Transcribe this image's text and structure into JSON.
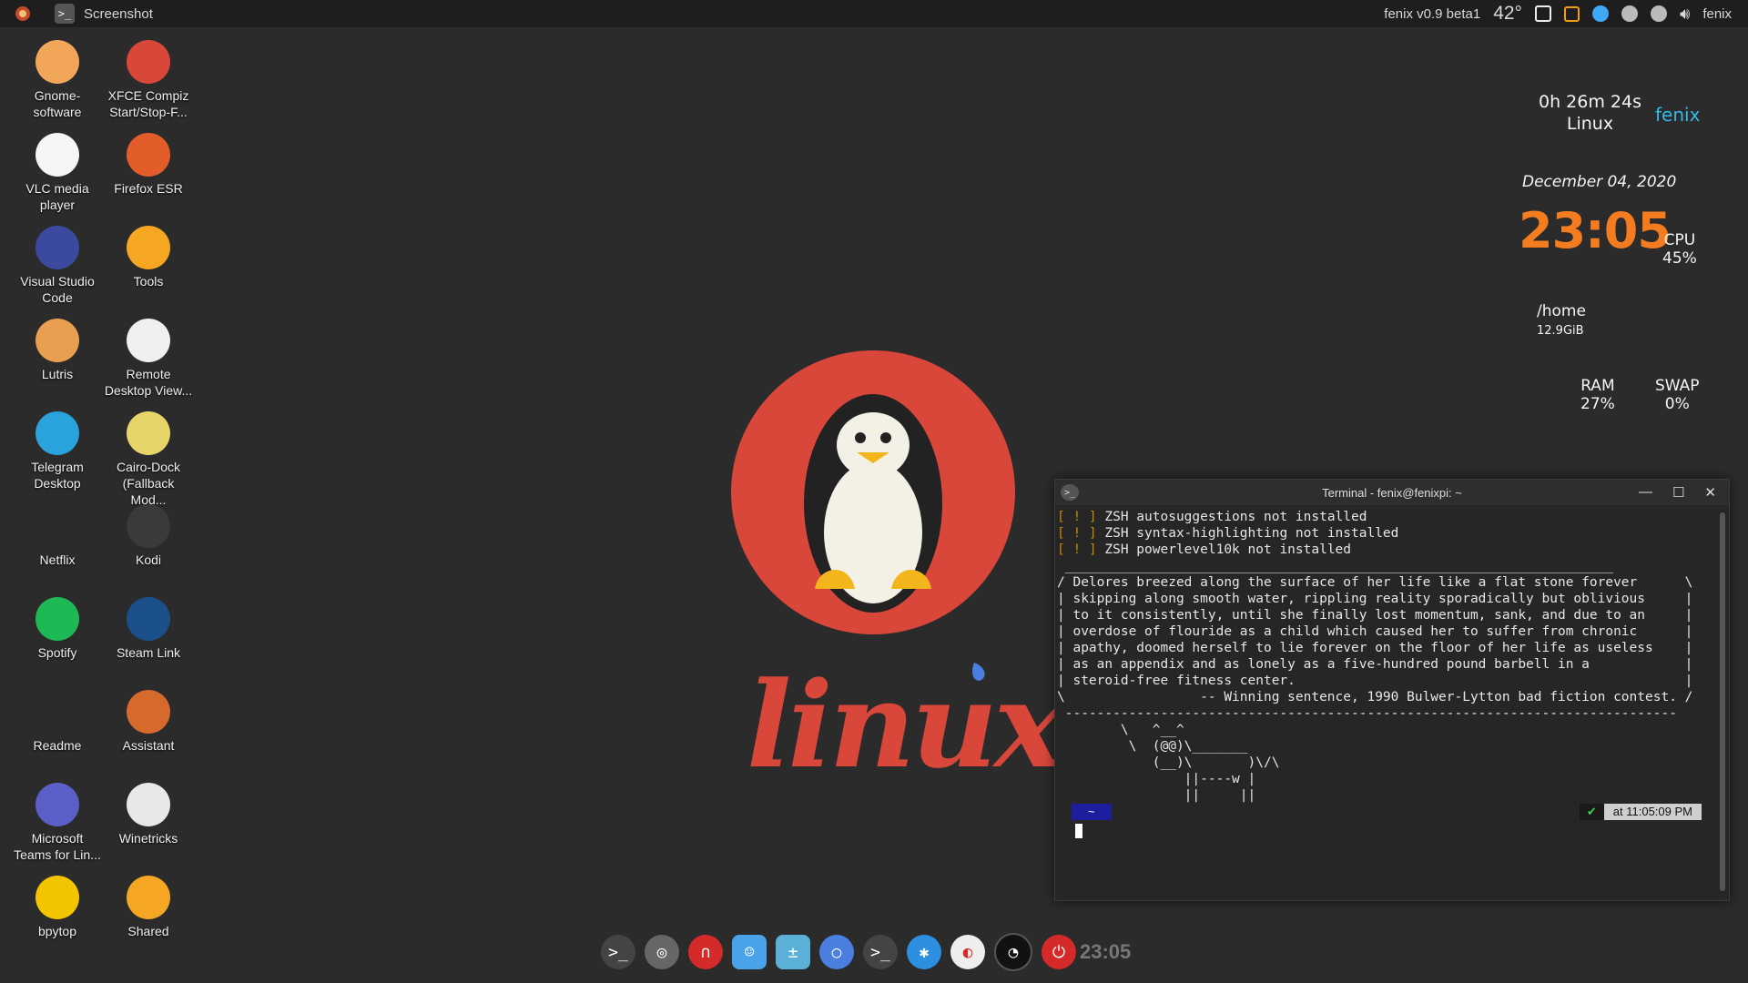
{
  "panel": {
    "active_app": "Screenshot",
    "version": "fenix v0.9 beta1",
    "temperature": "42°",
    "user": "fenix"
  },
  "desktop_icons": [
    {
      "label": "Gnome-software",
      "icon": "gnome-software-icon",
      "color": "#f2a65a"
    },
    {
      "label": "XFCE Compiz Start/Stop-F...",
      "icon": "compiz-icon",
      "color": "#d9473a"
    },
    {
      "label": "VLC media player",
      "icon": "vlc-icon",
      "color": "#f5f5f5"
    },
    {
      "label": "Firefox ESR",
      "icon": "firefox-icon",
      "color": "#e35d2a"
    },
    {
      "label": "Visual Studio Code",
      "icon": "vscode-icon",
      "color": "#3b4a9e"
    },
    {
      "label": "Tools",
      "icon": "folder-icon",
      "color": "#f5a623"
    },
    {
      "label": "Lutris",
      "icon": "lutris-icon",
      "color": "#e8a050"
    },
    {
      "label": "Remote Desktop View...",
      "icon": "remote-desktop-icon",
      "color": "#f0f0f0"
    },
    {
      "label": "Telegram Desktop",
      "icon": "telegram-icon",
      "color": "#2aa3dc"
    },
    {
      "label": "Cairo-Dock (Fallback Mod...",
      "icon": "cairo-dock-icon",
      "color": "#e8d56a"
    },
    {
      "label": "Netflix",
      "icon": "netflix-icon",
      "color": "#2b2b2b"
    },
    {
      "label": "Kodi",
      "icon": "kodi-icon",
      "color": "#3a3a3a"
    },
    {
      "label": "Spotify",
      "icon": "spotify-icon",
      "color": "#1db954"
    },
    {
      "label": "Steam Link",
      "icon": "steam-link-icon",
      "color": "#1b4f8a"
    },
    {
      "label": "Readme",
      "icon": "readme-icon",
      "color": "#2b2b2b"
    },
    {
      "label": "Assistant",
      "icon": "assistant-icon",
      "color": "#d66a2c"
    },
    {
      "label": "Microsoft Teams for Lin...",
      "icon": "teams-icon",
      "color": "#5b5fc7"
    },
    {
      "label": "Winetricks",
      "icon": "winetricks-icon",
      "color": "#e8e8e8"
    },
    {
      "label": "bpytop",
      "icon": "bpytop-icon",
      "color": "#f2c500"
    },
    {
      "label": "Shared",
      "icon": "shared-folder-icon",
      "color": "#f5a623"
    }
  ],
  "conky": {
    "uptime": "0h 26m 24s",
    "os": "Linux",
    "host": "fenix",
    "date": "December 04, 2020",
    "time": "23:05",
    "cpu_label": "CPU",
    "cpu_value": "45%",
    "home_label": "/home",
    "home_value": "12.9GiB",
    "ram_label": "RAM",
    "ram_value": "27%",
    "swap_label": "SWAP",
    "swap_value": "0%"
  },
  "wallpaper": {
    "word": "linux"
  },
  "terminal": {
    "title": "Terminal - fenix@fenixpi: ~",
    "warn_lines": [
      {
        "mark": "[ ! ]",
        "text": " ZSH autosuggestions not installed"
      },
      {
        "mark": "[ ! ]",
        "text": " ZSH syntax-highlighting not installed"
      },
      {
        "mark": "[ ! ]",
        "text": " ZSH powerlevel10k not installed"
      }
    ],
    "fortune": " _____________________________________________________________________\n/ Delores breezed along the surface of her life like a flat stone forever      \\\n| skipping along smooth water, rippling reality sporadically but oblivious     |\n| to it consistently, until she finally lost momentum, sank, and due to an     |\n| overdose of flouride as a child which caused her to suffer from chronic      |\n| apathy, doomed herself to lie forever on the floor of her life as useless    |\n| as an appendix and as lonely as a five-hundred pound barbell in a            |\n| steroid-free fitness center.                                                 |\n\\                 -- Winning sentence, 1990 Bulwer-Lytton bad fiction contest. /\n -----------------------------------------------------------------------------\n        \\   ^__^\n         \\  (@@)\\_______\n            (__)\\       )\\/\\\n                ||----w |\n                ||     ||",
    "prompt_dir": "~",
    "prompt_ok": "✔",
    "prompt_time": "at 11:05:09 PM"
  },
  "dock": {
    "items": [
      "terminal",
      "screenshot",
      "magnet",
      "finder",
      "calculator",
      "browser",
      "terminal-2",
      "bluetooth",
      "pie",
      "gauge",
      "power"
    ],
    "clock": "23:05"
  }
}
